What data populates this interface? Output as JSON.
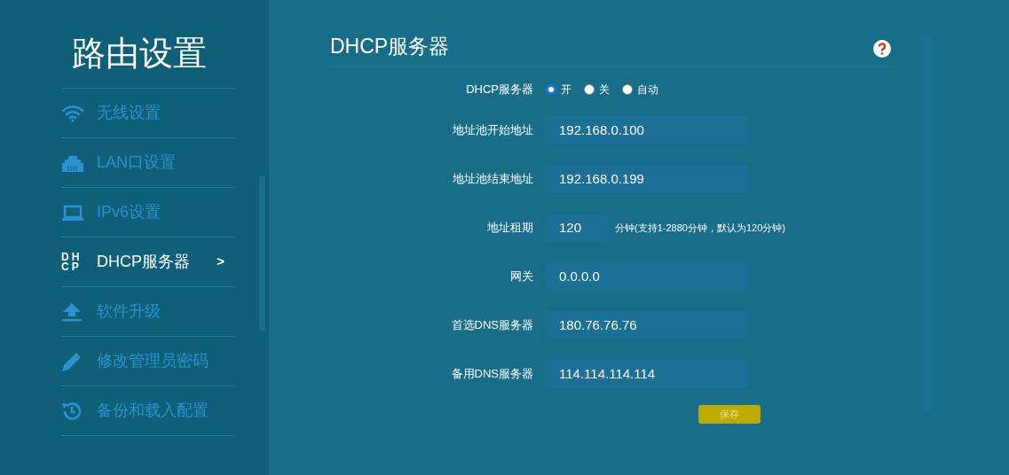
{
  "sidebar": {
    "title": "路由设置",
    "items": [
      {
        "kind": "wifi",
        "label": "无线设置",
        "selected": false
      },
      {
        "kind": "lan",
        "label": "LAN口设置",
        "selected": false
      },
      {
        "kind": "laptop",
        "label": "IPv6设置",
        "selected": false
      },
      {
        "kind": "dhcp",
        "icon_text": "DH CP",
        "label": "DHCP服务器",
        "selected": true,
        "arrow": ">"
      },
      {
        "kind": "upload",
        "label": "软件升级",
        "selected": false
      },
      {
        "kind": "pencil",
        "label": "修改管理员密码",
        "selected": false
      },
      {
        "kind": "history",
        "label": "备份和载入配置",
        "selected": false
      }
    ]
  },
  "page": {
    "title": "DHCP服务器",
    "fields": [
      {
        "kind": "radio",
        "label": "DHCP服务器",
        "options": [
          {
            "label": "开",
            "selected": true
          },
          {
            "label": "关",
            "selected": false
          },
          {
            "label": "自动",
            "selected": false
          }
        ]
      },
      {
        "kind": "input",
        "label": "地址池开始地址",
        "value": "192.168.0.100"
      },
      {
        "kind": "input",
        "label": "地址池结束地址",
        "value": "192.168.0.199"
      },
      {
        "kind": "short",
        "label": "地址租期",
        "value": "120",
        "hint": "分钟(支持1-2880分钟，默认为120分钟)"
      },
      {
        "kind": "input",
        "label": "网关",
        "value": "0.0.0.0"
      },
      {
        "kind": "input",
        "label": "首选DNS服务器",
        "value": "180.76.76.76"
      },
      {
        "kind": "input",
        "label": "备用DNS服务器",
        "value": "114.114.114.114"
      }
    ],
    "save_button": "保存"
  }
}
